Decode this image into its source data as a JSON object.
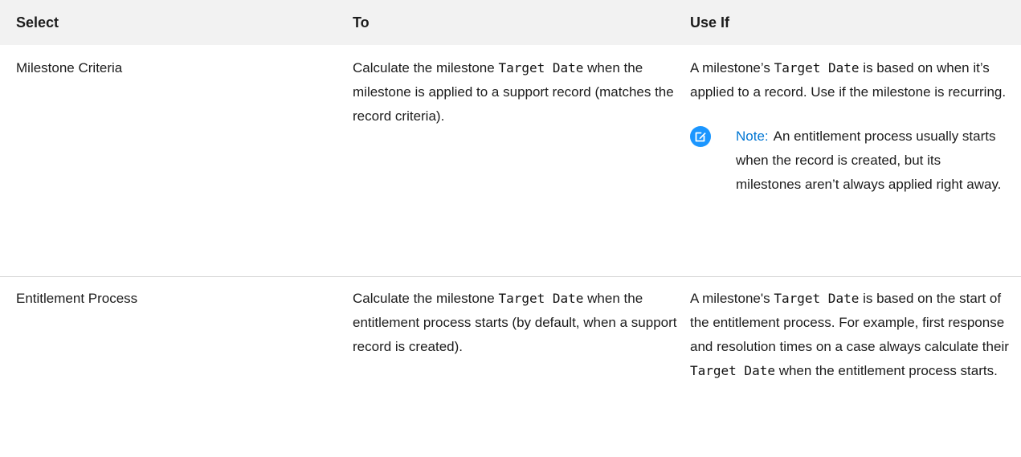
{
  "table": {
    "headers": [
      "Select",
      "To",
      "Use If"
    ],
    "rows": [
      {
        "select": "Milestone Criteria",
        "to_pre": "Calculate the milestone",
        "to_code": "Target Date",
        "to_post": "when the milestone is applied to a support record (matches the record criteria).",
        "use_pre": "A milestone’s",
        "use_code": "Target Date",
        "use_post": "is based on when it’s applied to a record. Use if the milestone is recurring.",
        "note": {
          "label": "Note:",
          "text": "An entitlement process usually starts when the record is created, but its milestones aren’t always applied right away.",
          "icon": "edit-note-icon"
        }
      },
      {
        "select": "Entitlement Process",
        "to_pre": "Calculate the milestone",
        "to_code": "Target Date",
        "to_post": "when the entitlement process starts (by default, when a support record is created).",
        "use_pre": "A milestone's",
        "use_code": "Target Date",
        "use_mid": "is based on the start of the entitlement process. For example, first response and resolution times on a case always calculate their",
        "use_code2": "Target Date",
        "use_post": "when the entitlement process starts."
      }
    ]
  },
  "colors": {
    "header_bg": "#f2f2f2",
    "divider": "#d4d4d4",
    "note_icon": "#1b96ff",
    "note_label": "#0176d3"
  }
}
